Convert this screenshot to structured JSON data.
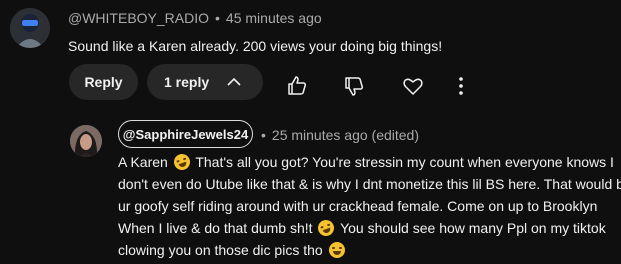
{
  "comment": {
    "author": "@WHITEBOY_RADIO",
    "time": "45 minutes ago",
    "text": "Sound like a Karen already. 200 views your doing big things!",
    "actions": {
      "reply_label": "Reply",
      "replies_label": "1 reply",
      "icons": [
        "thumbs-up-icon",
        "thumbs-down-icon",
        "heart-icon",
        "more-vert-icon"
      ]
    }
  },
  "reply": {
    "author": "@SapphireJewels24",
    "time": "25 minutes ago (edited)",
    "lines": [
      {
        "before": "A Karen ",
        "emoji": "rolling-on-floor-laughing",
        "after": " That's all you got? You're stressin my count when everyone knows  I"
      },
      {
        "text": "don't even do Utube like that & is why I dnt monetize this lil BS here. That would be"
      },
      {
        "text": "ur goofy self riding around with ur crackhead female. Come on up to Brooklyn"
      },
      {
        "before": "When I live & do that dumb sh!t ",
        "emoji": "rolling-on-floor-laughing",
        "after": " You should see how many Ppl on my tiktok"
      },
      {
        "before": "clowing you on those dic pics tho ",
        "emoji": "grinning-face-with-smiling-eyes",
        "after": ""
      }
    ]
  },
  "colors": {
    "background": "#0f0f0f",
    "text_primary": "#f1f1f1",
    "text_secondary": "#aaaaaa",
    "pill": "#272727"
  }
}
